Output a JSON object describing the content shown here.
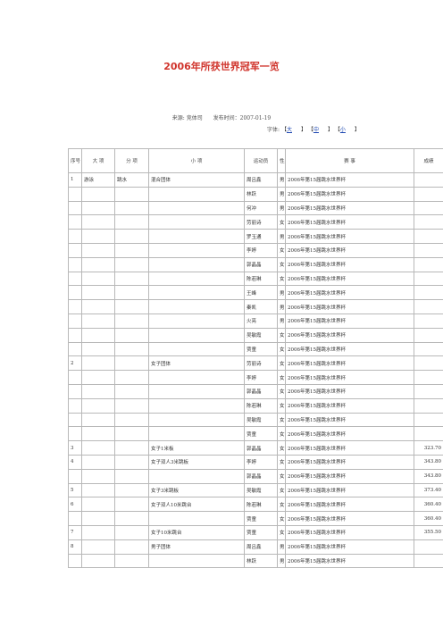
{
  "page": {
    "title": "2006年所获世界冠军一览",
    "source_label": "来源: 竞体司",
    "date_label": "发布时间：2007-01-19",
    "font_label": "字体:",
    "font_large": "大",
    "font_medium": "中",
    "font_small": "小",
    "bracket_open": "【",
    "bracket_close": "】"
  },
  "table": {
    "headers": {
      "seq": "序号",
      "major": "大 项",
      "sub": "分 项",
      "item": "小 项",
      "athlete": "运动员",
      "gender": "性别",
      "event": "赛 事",
      "score": "成绩"
    },
    "rows": [
      {
        "seq": "1",
        "major": "游泳",
        "sub": "跳水",
        "item": "混合团体",
        "athlete": "周吕鑫",
        "gender": "男",
        "event": "2006年第15届跳水世界杯",
        "score": ""
      },
      {
        "seq": "",
        "major": "",
        "sub": "",
        "item": "",
        "athlete": "林跃",
        "gender": "男",
        "event": "2006年第15届跳水世界杯",
        "score": ""
      },
      {
        "seq": "",
        "major": "",
        "sub": "",
        "item": "",
        "athlete": "何冲",
        "gender": "男",
        "event": "2006年第15届跳水世界杯",
        "score": ""
      },
      {
        "seq": "",
        "major": "",
        "sub": "",
        "item": "",
        "athlete": "劳丽诗",
        "gender": "女",
        "event": "2006年第15届跳水世界杯",
        "score": ""
      },
      {
        "seq": "",
        "major": "",
        "sub": "",
        "item": "",
        "athlete": "罗玉通",
        "gender": "男",
        "event": "2006年第15届跳水世界杯",
        "score": ""
      },
      {
        "seq": "",
        "major": "",
        "sub": "",
        "item": "",
        "athlete": "李婷",
        "gender": "女",
        "event": "2006年第15届跳水世界杯",
        "score": ""
      },
      {
        "seq": "",
        "major": "",
        "sub": "",
        "item": "",
        "athlete": "郭晶晶",
        "gender": "女",
        "event": "2006年第15届跳水世界杯",
        "score": ""
      },
      {
        "seq": "",
        "major": "",
        "sub": "",
        "item": "",
        "athlete": "陈若琳",
        "gender": "女",
        "event": "2006年第15届跳水世界杯",
        "score": ""
      },
      {
        "seq": "",
        "major": "",
        "sub": "",
        "item": "",
        "athlete": "王峰",
        "gender": "男",
        "event": "2006年第15届跳水世界杯",
        "score": ""
      },
      {
        "seq": "",
        "major": "",
        "sub": "",
        "item": "",
        "athlete": "秦凯",
        "gender": "男",
        "event": "2006年第15届跳水世界杯",
        "score": ""
      },
      {
        "seq": "",
        "major": "",
        "sub": "",
        "item": "",
        "athlete": "火亮",
        "gender": "男",
        "event": "2006年第15届跳水世界杯",
        "score": ""
      },
      {
        "seq": "",
        "major": "",
        "sub": "",
        "item": "",
        "athlete": "吴敏霞",
        "gender": "女",
        "event": "2006年第15届跳水世界杯",
        "score": ""
      },
      {
        "seq": "",
        "major": "",
        "sub": "",
        "item": "",
        "athlete": "贾童",
        "gender": "女",
        "event": "2006年第15届跳水世界杯",
        "score": ""
      },
      {
        "seq": "2",
        "major": "",
        "sub": "",
        "item": "女子团体",
        "athlete": "劳丽诗",
        "gender": "女",
        "event": "2006年第15届跳水世界杯",
        "score": ""
      },
      {
        "seq": "",
        "major": "",
        "sub": "",
        "item": "",
        "athlete": "李婷",
        "gender": "女",
        "event": "2006年第15届跳水世界杯",
        "score": ""
      },
      {
        "seq": "",
        "major": "",
        "sub": "",
        "item": "",
        "athlete": "郭晶晶",
        "gender": "女",
        "event": "2006年第15届跳水世界杯",
        "score": ""
      },
      {
        "seq": "",
        "major": "",
        "sub": "",
        "item": "",
        "athlete": "陈若琳",
        "gender": "女",
        "event": "2006年第15届跳水世界杯",
        "score": ""
      },
      {
        "seq": "",
        "major": "",
        "sub": "",
        "item": "",
        "athlete": "吴敏霞",
        "gender": "女",
        "event": "2006年第15届跳水世界杯",
        "score": ""
      },
      {
        "seq": "",
        "major": "",
        "sub": "",
        "item": "",
        "athlete": "贾童",
        "gender": "女",
        "event": "2006年第15届跳水世界杯",
        "score": ""
      },
      {
        "seq": "3",
        "major": "",
        "sub": "",
        "item": "女子1米板",
        "athlete": "郭晶晶",
        "gender": "女",
        "event": "2006年第15届跳水世界杯",
        "score": "323.70"
      },
      {
        "seq": "4",
        "major": "",
        "sub": "",
        "item": "女子双人3米跳板",
        "athlete": "李婷",
        "gender": "女",
        "event": "2006年第15届跳水世界杯",
        "score": "343.80"
      },
      {
        "seq": "",
        "major": "",
        "sub": "",
        "item": "",
        "athlete": "郭晶晶",
        "gender": "女",
        "event": "2006年第15届跳水世界杯",
        "score": "343.80"
      },
      {
        "seq": "5",
        "major": "",
        "sub": "",
        "item": "女子3米跳板",
        "athlete": "吴敏霞",
        "gender": "女",
        "event": "2006年第15届跳水世界杯",
        "score": "373.40"
      },
      {
        "seq": "6",
        "major": "",
        "sub": "",
        "item": "女子双人10米跳台",
        "athlete": "陈若琳",
        "gender": "女",
        "event": "2006年第15届跳水世界杯",
        "score": "360.40"
      },
      {
        "seq": "",
        "major": "",
        "sub": "",
        "item": "",
        "athlete": "贾童",
        "gender": "女",
        "event": "2006年第15届跳水世界杯",
        "score": "360.40"
      },
      {
        "seq": "7",
        "major": "",
        "sub": "",
        "item": "女子10米跳台",
        "athlete": "贾童",
        "gender": "女",
        "event": "2006年第15届跳水世界杯",
        "score": "355.50"
      },
      {
        "seq": "8",
        "major": "",
        "sub": "",
        "item": "男子团体",
        "athlete": "周吕鑫",
        "gender": "男",
        "event": "2006年第15届跳水世界杯",
        "score": ""
      },
      {
        "seq": "",
        "major": "",
        "sub": "",
        "item": "",
        "athlete": "林跃",
        "gender": "男",
        "event": "2006年第15届跳水世界杯",
        "score": ""
      }
    ]
  }
}
